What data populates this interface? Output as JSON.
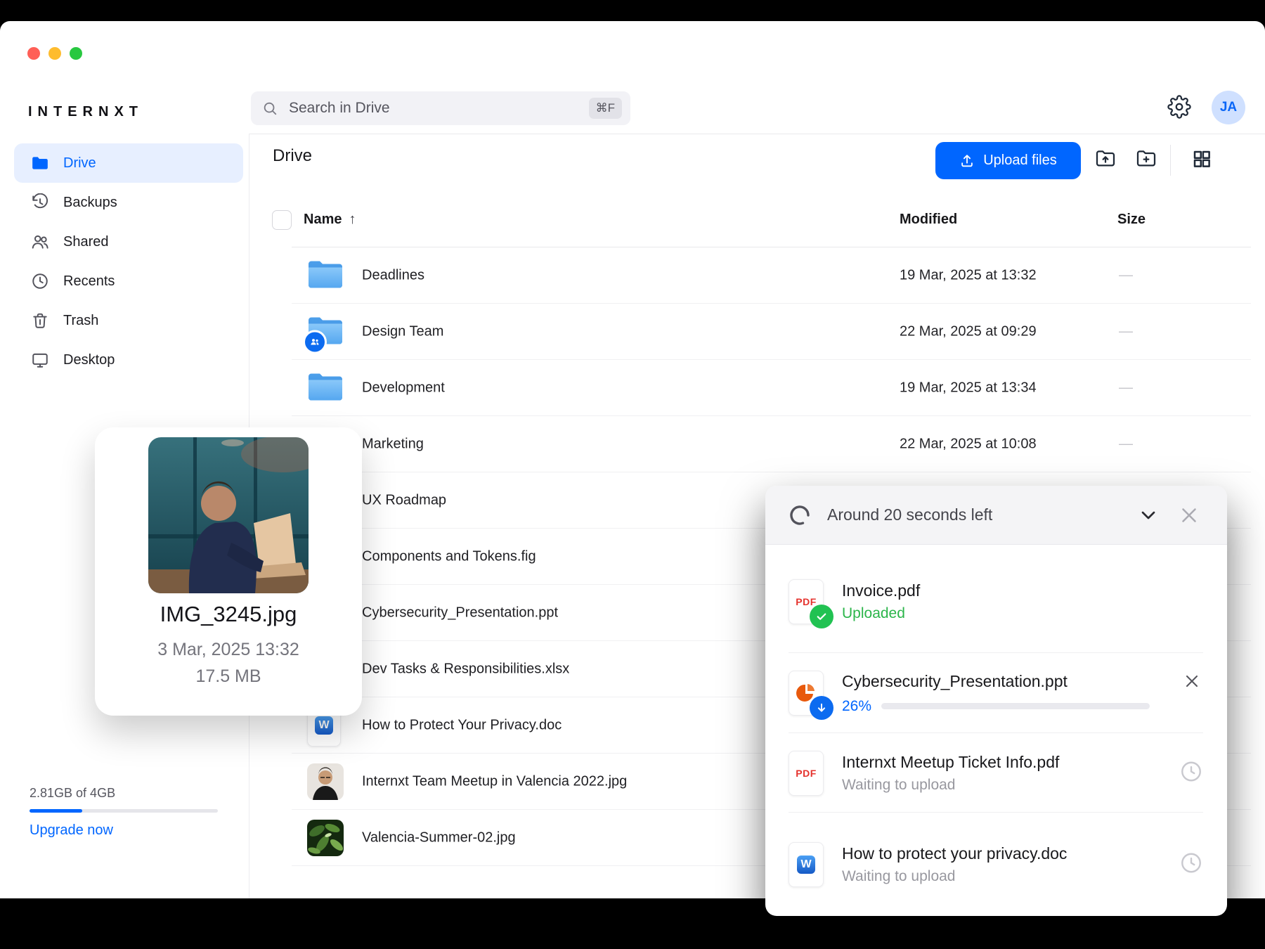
{
  "topbar": {
    "logo": "INTERNXT",
    "search": {
      "placeholder": "Search in Drive",
      "shortcut": "⌘F"
    },
    "avatar_initials": "JA"
  },
  "sidebar": {
    "items": [
      {
        "label": "Drive",
        "icon": "folder",
        "active": true
      },
      {
        "label": "Backups",
        "icon": "history",
        "active": false
      },
      {
        "label": "Shared",
        "icon": "people",
        "active": false
      },
      {
        "label": "Recents",
        "icon": "clock",
        "active": false
      },
      {
        "label": "Trash",
        "icon": "trash",
        "active": false
      },
      {
        "label": "Desktop",
        "icon": "monitor",
        "active": false
      }
    ],
    "storage": {
      "usage": "2.81GB of 4GB",
      "percent_used": 28,
      "upgrade_label": "Upgrade now"
    }
  },
  "main": {
    "title": "Drive",
    "upload_button_label": "Upload files",
    "columns": {
      "name": "Name",
      "sort_arrow": "↑",
      "modified": "Modified",
      "size": "Size"
    },
    "rows": [
      {
        "name": "Deadlines",
        "type": "folder",
        "modified": "19 Mar, 2025 at 13:32",
        "size": "—"
      },
      {
        "name": "Design Team",
        "type": "folder-shared",
        "modified": "22 Mar, 2025 at 09:29",
        "size": "—"
      },
      {
        "name": "Development",
        "type": "folder",
        "modified": "19 Mar, 2025 at 13:34",
        "size": "—"
      },
      {
        "name": "Marketing",
        "type": "folder",
        "modified": "22 Mar, 2025 at 10:08",
        "size": "—"
      },
      {
        "name": "UX Roadmap",
        "type": "folder",
        "modified": "",
        "size": ""
      },
      {
        "name": "Components and Tokens.fig",
        "type": "file",
        "modified": "",
        "size": ""
      },
      {
        "name": "Cybersecurity_Presentation.ppt",
        "type": "file",
        "modified": "",
        "size": ""
      },
      {
        "name": "Dev Tasks & Responsibilities.xlsx",
        "type": "file",
        "modified": "",
        "size": ""
      },
      {
        "name": "How to Protect Your Privacy.doc",
        "type": "doc",
        "modified": "",
        "size": ""
      },
      {
        "name": "Internxt Team Meetup in Valencia 2022.jpg",
        "type": "image",
        "modified": "",
        "size": ""
      },
      {
        "name": "Valencia-Summer-02.jpg",
        "type": "image",
        "modified": "",
        "size": ""
      }
    ]
  },
  "preview_card": {
    "filename": "IMG_3245.jpg",
    "date": "3 Mar, 2025 13:32",
    "size": "17.5 MB"
  },
  "upload_panel": {
    "time_left": "Around 20 seconds left",
    "items": [
      {
        "name": "Invoice.pdf",
        "file_type": "pdf",
        "status": "Uploaded"
      },
      {
        "name": "Cybersecurity_Presentation.ppt",
        "file_type": "ppt",
        "progress_percent": 26,
        "progress_label": "26%"
      },
      {
        "name": "Internxt Meetup Ticket Info.pdf",
        "file_type": "pdf",
        "status": "Waiting to upload"
      },
      {
        "name": "How to protect your privacy.doc",
        "file_type": "doc",
        "status": "Waiting to upload"
      }
    ]
  },
  "labels": {
    "pdf_icon_text": "PDF",
    "word_icon_text": "W"
  },
  "colors": {
    "accent": "#0066FF",
    "success": "#2BB54A",
    "folder_blue": "#55A7F0"
  }
}
